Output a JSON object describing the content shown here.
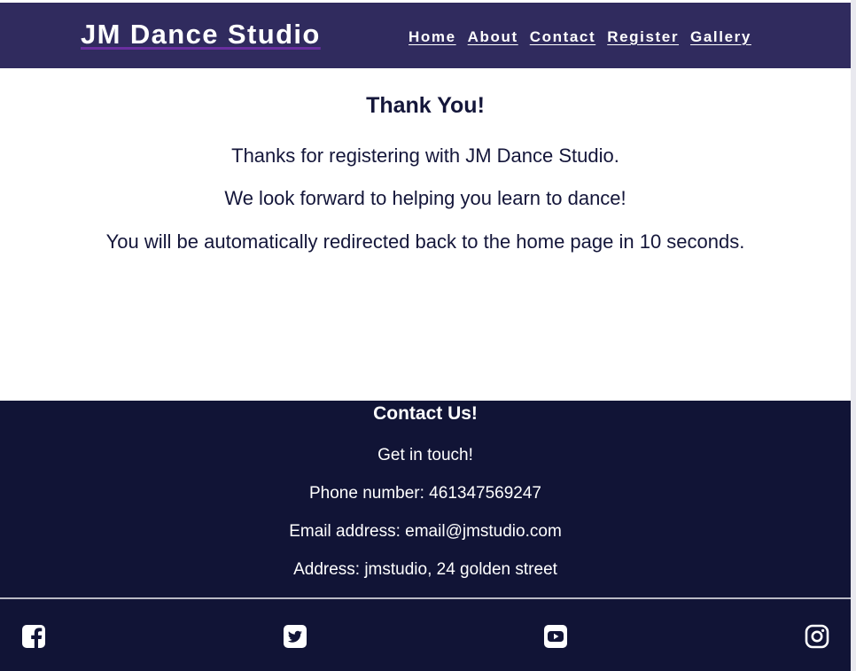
{
  "header": {
    "brand": "JM Dance Studio",
    "nav": [
      "Home",
      "About",
      "Contact",
      "Register",
      "Gallery"
    ]
  },
  "main": {
    "title": "Thank You!",
    "line1": "Thanks for registering with JM Dance Studio.",
    "line2": "We look forward to helping you learn to dance!",
    "line3": "You will be automatically redirected back to the home page in 10 seconds."
  },
  "footer": {
    "title": "Contact Us!",
    "subtitle": "Get in touch!",
    "phone": "Phone number: 461347569247",
    "email": "Email address: email@jmstudio.com",
    "address": "Address: jmstudio, 24 golden street",
    "social_icons": [
      "facebook-icon",
      "twitter-icon",
      "youtube-icon",
      "instagram-icon"
    ]
  },
  "colors": {
    "header_bg": "#302b5e",
    "footer_bg": "#111436",
    "text_dark": "#14163a"
  }
}
